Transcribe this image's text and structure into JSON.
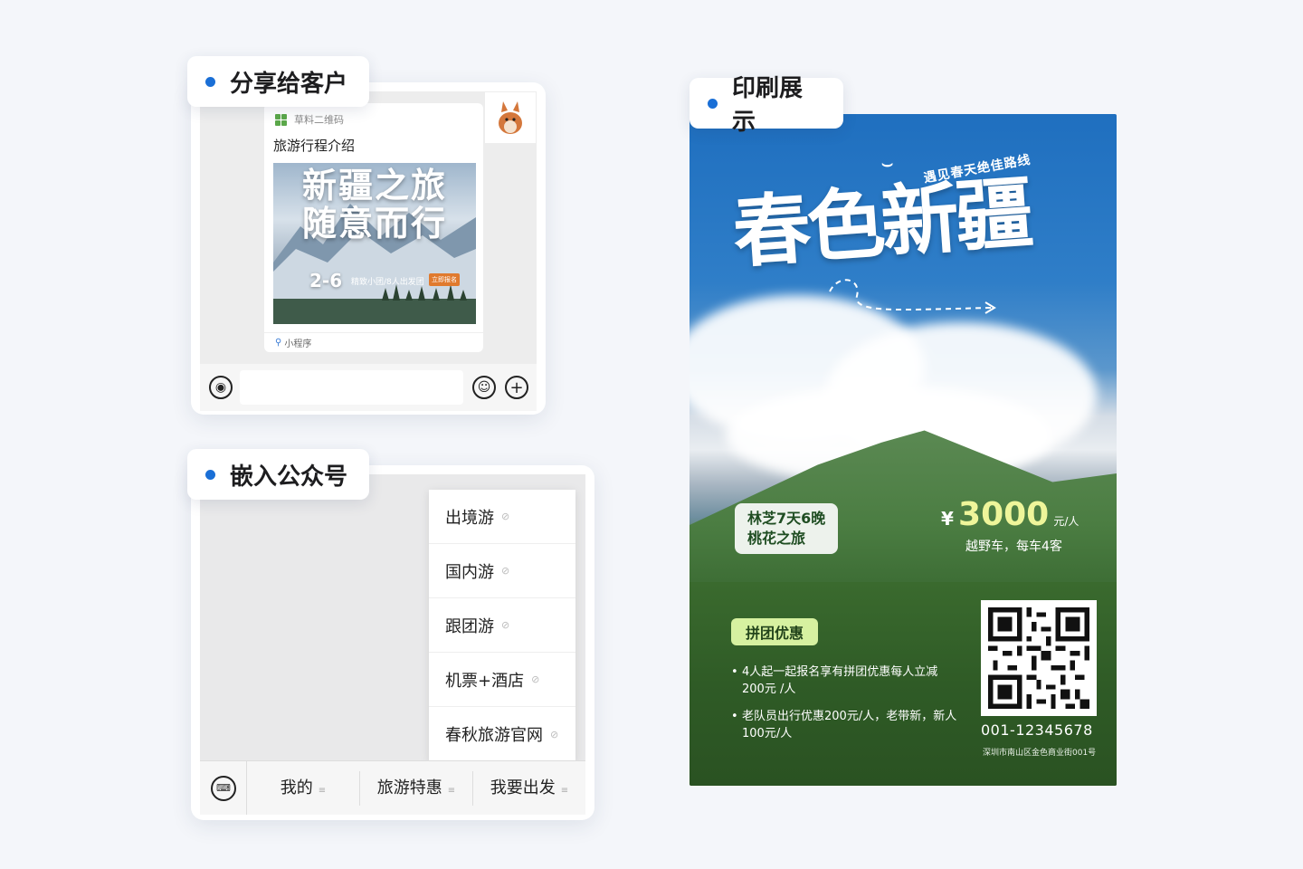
{
  "share": {
    "tag_label": "分享给客户",
    "source_name": "草料二维码",
    "message_title": "旅游行程介绍",
    "cover_line1": "新疆之旅",
    "cover_line2": "随意而行",
    "cover_date": "2-6",
    "cover_sub": "精致小团/8人出发团",
    "cover_badge": "立即报名",
    "footer_label": "小程序",
    "voice_icon": "voice-icon",
    "emoji_icon": "emoji-icon",
    "plus_icon": "plus-icon"
  },
  "official_account": {
    "tag_label": "嵌入公众号",
    "dropdown_items": [
      "出境游",
      "国内游",
      "跟团游",
      "机票+酒店",
      "春秋旅游官网"
    ],
    "menu_items": [
      "我的",
      "旅游特惠",
      "我要出发"
    ],
    "keyboard_icon": "keyboard-icon"
  },
  "poster": {
    "tag_label": "印刷展示",
    "tagline": "遇见春天绝佳路线",
    "headline": "春色新疆",
    "route_line1": "林芝7天6晚",
    "route_line2": "桃花之旅",
    "price_symbol": "¥",
    "price_value": "3000",
    "price_unit": "元/人",
    "price_sub": "越野车，每车4客",
    "promo_pill": "拼团优惠",
    "bullet1": "4人起一起报名享有拼团优惠每人立减200元 /人",
    "bullet2": "老队员出行优惠200元/人，老带新，新人100元/人",
    "phone": "001-12345678",
    "address": "深圳市南山区金色商业街001号"
  },
  "colors": {
    "accent_dot": "#1a6fd6",
    "price_highlight": "#eef59a",
    "pill_bg": "#d6f1a0"
  }
}
